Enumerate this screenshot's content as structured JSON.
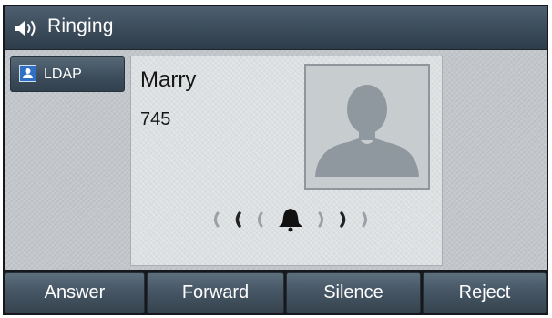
{
  "header": {
    "title": "Ringing",
    "icon": "speaker-volume-icon"
  },
  "directory": {
    "label": "LDAP",
    "icon": "contact-card-icon"
  },
  "caller": {
    "name": "Marry",
    "number": "745",
    "avatar_icon": "person-silhouette-icon",
    "ringing_icon": "bell-icon"
  },
  "softkeys": [
    {
      "label": "Answer"
    },
    {
      "label": "Forward"
    },
    {
      "label": "Silence"
    },
    {
      "label": "Reject"
    }
  ],
  "colors": {
    "header_bg": "#3b4b5a",
    "softkey_bg": "#465665",
    "contact_icon_blue": "#2f6fc4"
  }
}
